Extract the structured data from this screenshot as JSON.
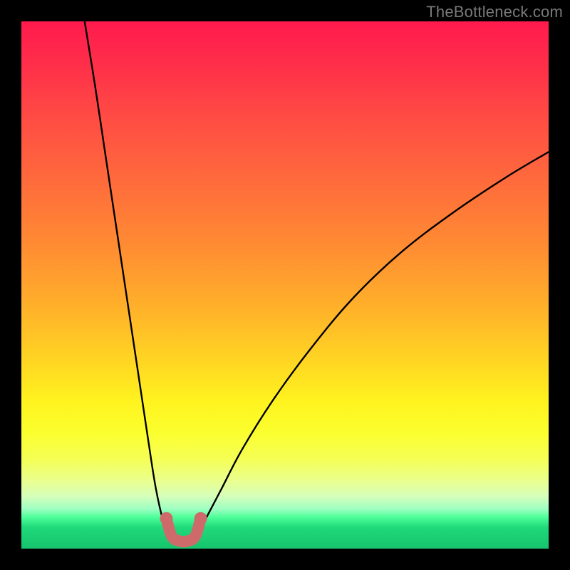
{
  "watermark": "TheBottleneck.com",
  "chart_data": {
    "type": "line",
    "title": "",
    "xlabel": "",
    "ylabel": "",
    "xlim": [
      0,
      100
    ],
    "ylim": [
      0,
      105
    ],
    "grid": false,
    "legend": false,
    "series": [
      {
        "name": "black-curve-left",
        "color": "#000000",
        "x": [
          12,
          14,
          16,
          18,
          20,
          22,
          24,
          25.5,
          27,
          28
        ],
        "y": [
          105,
          92,
          78,
          64,
          50,
          36,
          22,
          12,
          5,
          2
        ]
      },
      {
        "name": "black-curve-right",
        "color": "#000000",
        "x": [
          33,
          35,
          38,
          42,
          48,
          55,
          63,
          72,
          82,
          92,
          100
        ],
        "y": [
          2,
          6,
          12,
          20,
          30,
          40,
          50,
          59,
          67,
          74,
          79
        ]
      },
      {
        "name": "red-marker-segment",
        "color": "#cf6a6a",
        "x": [
          27.5,
          28.5,
          30,
          31.5,
          33,
          34
        ],
        "y": [
          6,
          2.5,
          1.5,
          1.5,
          2.5,
          6
        ]
      }
    ],
    "annotations": []
  },
  "colors": {
    "gradient_top": "#ff1a4d",
    "gradient_mid": "#ffd423",
    "gradient_bottom": "#17c46d",
    "curve": "#000000",
    "marker": "#cf6a6a",
    "frame": "#000000",
    "watermark": "#7a7a7a"
  }
}
